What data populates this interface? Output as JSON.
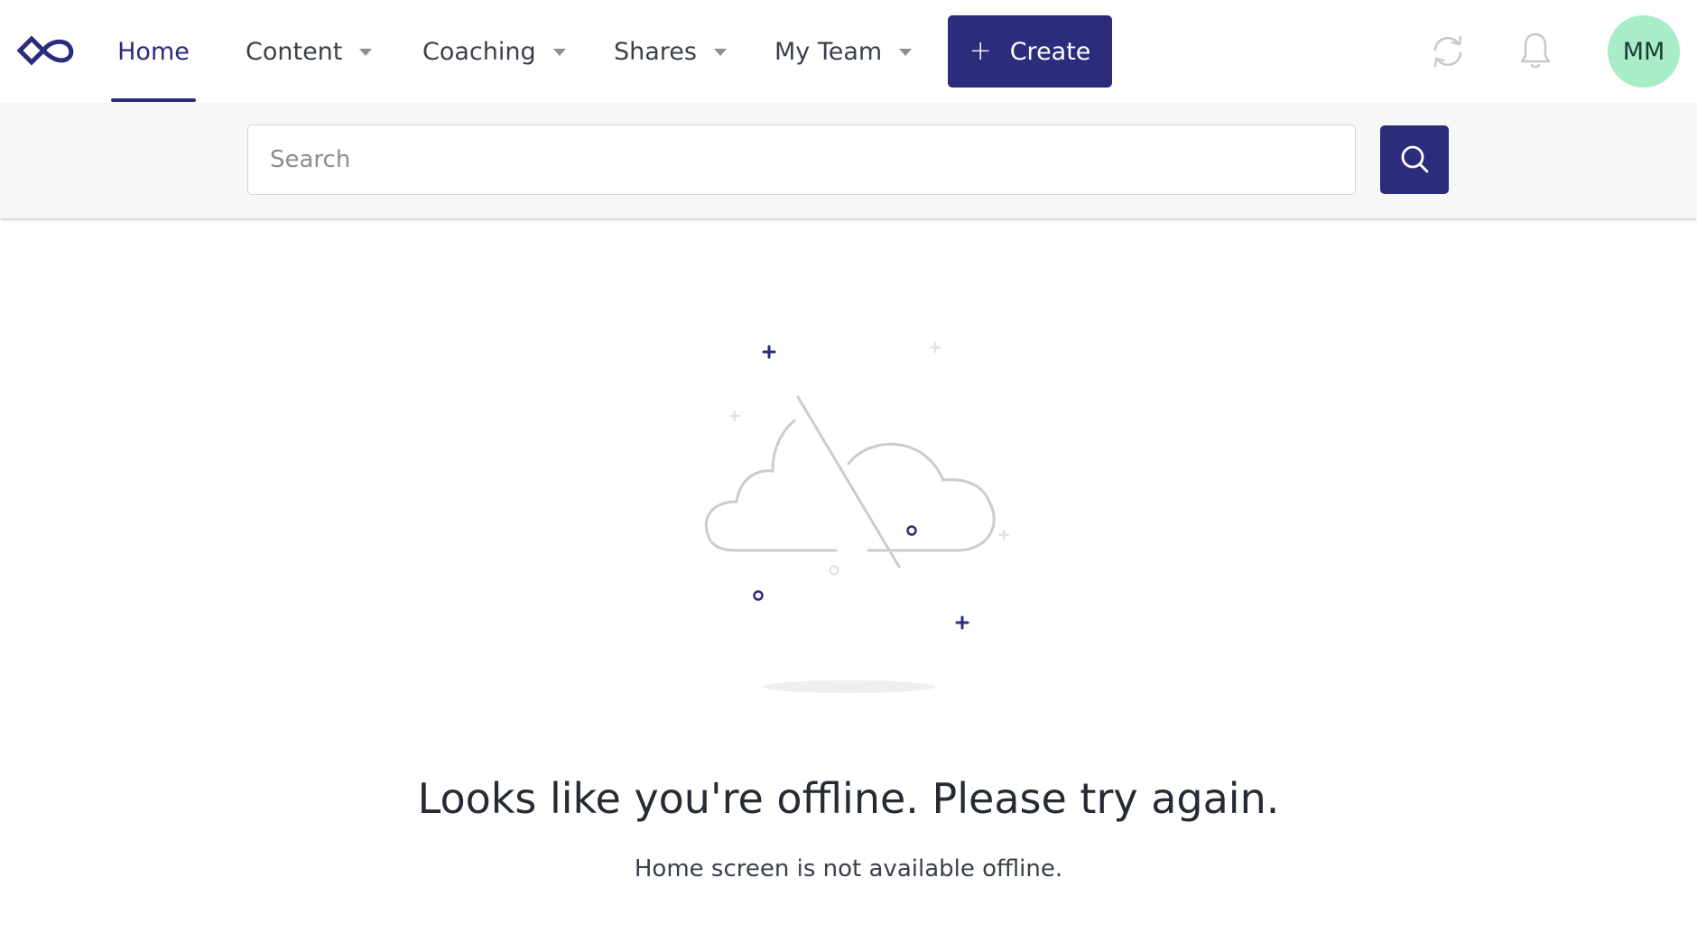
{
  "nav": {
    "logo_icon": "infinity-logo-icon",
    "items": [
      {
        "label": "Home",
        "active": true,
        "has_dropdown": false
      },
      {
        "label": "Content",
        "active": false,
        "has_dropdown": true
      },
      {
        "label": "Coaching",
        "active": false,
        "has_dropdown": true
      },
      {
        "label": "Shares",
        "active": false,
        "has_dropdown": true
      },
      {
        "label": "My Team",
        "active": false,
        "has_dropdown": true
      }
    ],
    "create_label": "Create",
    "create_icon": "plus-icon",
    "sync_icon": "sync-icon",
    "bell_icon": "bell-icon",
    "avatar_initials": "MM"
  },
  "search": {
    "placeholder": "Search",
    "value": "",
    "button_icon": "search-icon"
  },
  "empty_state": {
    "illustration": "offline-cloud-illustration",
    "title": "Looks like you're offline. Please try again.",
    "subtitle": "Home screen is not available offline."
  },
  "colors": {
    "brand": "#2b2c7c",
    "avatar_bg": "#a8ecc8",
    "search_band_bg": "#f7f7f7",
    "icon_gray": "#c8c8c8"
  }
}
